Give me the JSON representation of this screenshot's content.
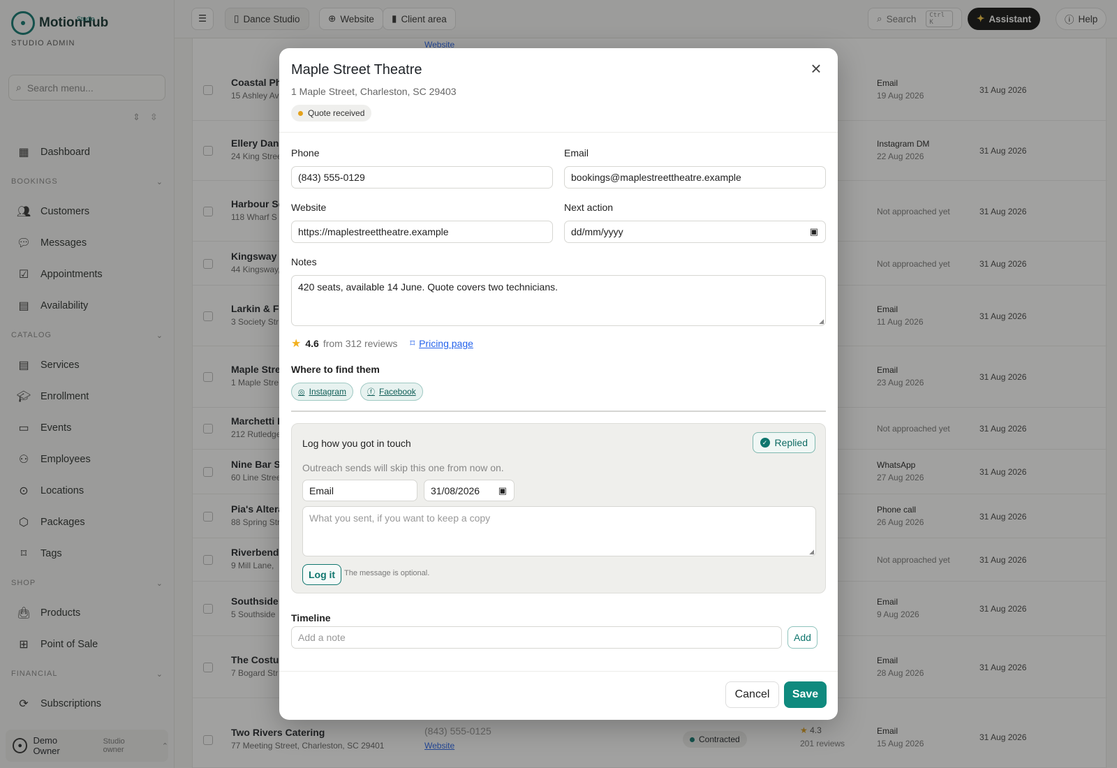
{
  "app": {
    "name": "MotionHub",
    "sub": "Studio",
    "role": "STUDIO ADMIN"
  },
  "sidebar": {
    "search_placeholder": "Search menu...",
    "dashboard": "Dashboard",
    "sections": [
      {
        "title": "BOOKINGS",
        "items": [
          "Customers",
          "Messages",
          "Appointments",
          "Availability"
        ]
      },
      {
        "title": "CATALOG",
        "items": [
          "Services",
          "Enrollment",
          "Events",
          "Employees",
          "Locations",
          "Packages",
          "Tags"
        ]
      },
      {
        "title": "SHOP",
        "items": [
          "Products",
          "Point of Sale"
        ]
      },
      {
        "title": "FINANCIAL",
        "items": [
          "Subscriptions"
        ]
      }
    ],
    "user": {
      "name": "Demo Owner",
      "role": "Studio owner"
    }
  },
  "topbar": {
    "studio": "Dance Studio",
    "website": "Website",
    "client_area": "Client area",
    "search": "Search",
    "shortcut": "Ctrl K",
    "assistant": "Assistant",
    "help": "Help"
  },
  "table": {
    "top_link": "Website",
    "rows": [
      {
        "name": "Coastal Ph",
        "address": "15 Ashley Av",
        "channel": "Email",
        "channel_date": "19 Aug 2026",
        "date": "31 Aug 2026"
      },
      {
        "name": "Ellery Danc",
        "address": "24 King Stree",
        "channel": "Instagram DM",
        "channel_date": "22 Aug 2026",
        "date": "31 Aug 2026"
      },
      {
        "name": "Harbour Sc",
        "address": "118 Wharf S",
        "channel": "Not approached yet",
        "channel_date": "",
        "date": "31 Aug 2026"
      },
      {
        "name": "Kingsway C",
        "address": "44 Kingsway,",
        "channel": "Not approached yet",
        "channel_date": "",
        "date": "31 Aug 2026"
      },
      {
        "name": "Larkin & Fo",
        "address": "3 Society Str",
        "channel": "Email",
        "channel_date": "11 Aug 2026",
        "date": "31 Aug 2026"
      },
      {
        "name": "Maple Stre",
        "address": "1 Maple Stre",
        "channel": "Email",
        "channel_date": "23 Aug 2026",
        "date": "31 Aug 2026"
      },
      {
        "name": "Marchetti F",
        "address": "212 Rutledge",
        "channel": "Not approached yet",
        "channel_date": "",
        "date": "31 Aug 2026"
      },
      {
        "name": "Nine Bar St",
        "address": "60 Line Stree",
        "channel": "WhatsApp",
        "channel_date": "27 Aug 2026",
        "date": "31 Aug 2026"
      },
      {
        "name": "Pia's Altera",
        "address": "88 Spring Str",
        "channel": "Phone call",
        "channel_date": "26 Aug 2026",
        "date": "31 Aug 2026"
      },
      {
        "name": "Riverbend",
        "address": "9 Mill Lane,",
        "channel": "Not approached yet",
        "channel_date": "",
        "date": "31 Aug 2026"
      },
      {
        "name": "Southside C",
        "address": "5 Southside",
        "channel": "Email",
        "channel_date": "9 Aug 2026",
        "date": "31 Aug 2026"
      },
      {
        "name": "The Costur",
        "address": "7 Bogard Str",
        "channel": "Email",
        "channel_date": "28 Aug 2026",
        "date": "31 Aug 2026"
      }
    ],
    "last_row": {
      "name": "Two Rivers Catering",
      "address": "77 Meeting Street, Charleston, SC 29401",
      "phone": "(843) 555-0125",
      "website": "Website",
      "status": "Contracted",
      "rating": "4.3",
      "reviews": "201 reviews",
      "channel": "Email",
      "channel_date": "15 Aug 2026",
      "date": "31 Aug 2026"
    }
  },
  "modal": {
    "title": "Maple Street Theatre",
    "address": "1 Maple Street, Charleston, SC 29403",
    "status": "Quote received",
    "phone_label": "Phone",
    "phone": "(843) 555-0129",
    "email_label": "Email",
    "email": "bookings@maplestreettheatre.example",
    "website_label": "Website",
    "website": "https://maplestreettheatre.example",
    "next_action_label": "Next action",
    "next_action_placeholder": "dd/mm/yyyy",
    "notes_label": "Notes",
    "notes": "420 seats, available 14 June. Quote covers two technicians.",
    "rating": "4.6",
    "reviews": "from 312 reviews",
    "pricing_link": "Pricing page",
    "where_title": "Where to find them",
    "links": [
      "Instagram",
      "Facebook"
    ],
    "log": {
      "title": "Log how you got in touch",
      "replied": "Replied",
      "subtitle": "Outreach sends will skip this one from now on.",
      "channel": "Email",
      "date": "31/08/2026",
      "message_placeholder": "What you sent, if you want to keep a copy",
      "button": "Log it",
      "hint": "The message is optional."
    },
    "timeline_title": "Timeline",
    "timeline_placeholder": "Add a note",
    "add": "Add",
    "cancel": "Cancel",
    "save": "Save"
  }
}
